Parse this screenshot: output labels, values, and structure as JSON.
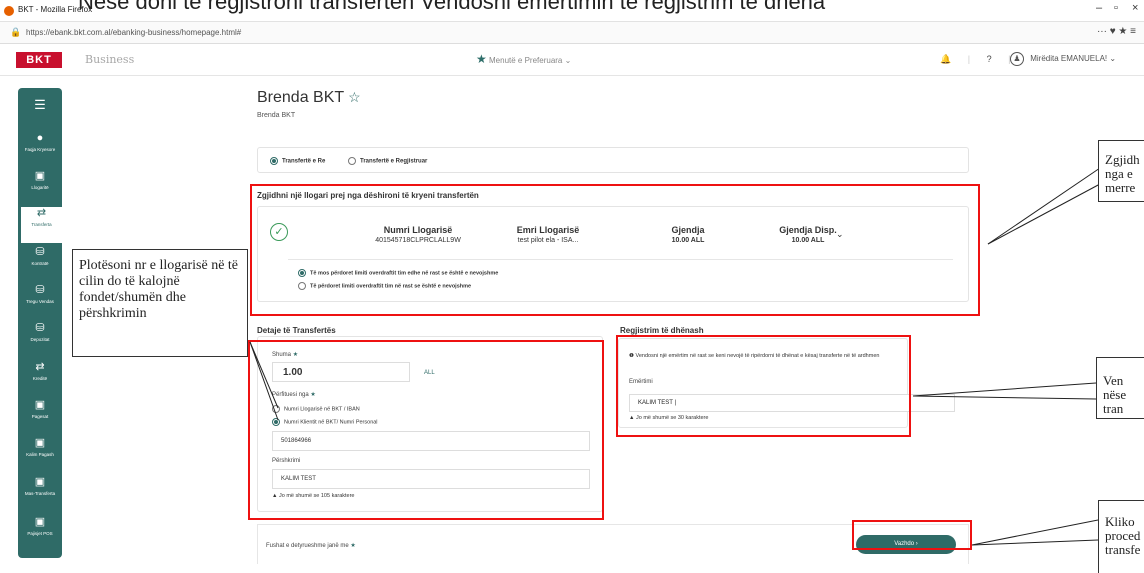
{
  "window": {
    "title": "BKT - Mozilla Firefox",
    "overlay_text": "Nëse doni të regjistroni transferten Vendosni emërtimin të regjistrim të dhëna",
    "controls": [
      "–",
      "▫",
      "×"
    ]
  },
  "browser": {
    "url": "https://ebank.bkt.com.al/ebanking-business/homepage.html#",
    "tools": "··· ♥ ★ ≡"
  },
  "header": {
    "logo": "BKT",
    "product": "Business",
    "menu_pref": "Menutë e Preferuara",
    "help": "?",
    "user": "Mirëdita EMANUELA!"
  },
  "sidebar": {
    "items": [
      {
        "label": "Faqja Kryesore",
        "icon": "home-icon"
      },
      {
        "label": "Llogaritë",
        "icon": "accounts-icon"
      },
      {
        "label": "Transferta",
        "icon": "transfer-icon"
      },
      {
        "label": "Kontratë",
        "icon": "contract-icon"
      },
      {
        "label": "Tregu Vendas",
        "icon": "market-icon"
      },
      {
        "label": "Depozitat",
        "icon": "deposit-icon"
      },
      {
        "label": "Kreditë",
        "icon": "credit-icon"
      },
      {
        "label": "Pagesat",
        "icon": "payments-icon"
      },
      {
        "label": "Kalim Pagash",
        "icon": "payroll-icon"
      },
      {
        "label": "Mas-Transferta",
        "icon": "mass-transfer-icon"
      },
      {
        "label": "Pajisjet POS",
        "icon": "pos-icon"
      }
    ]
  },
  "page": {
    "title": "Brenda BKT",
    "subtitle": "Brenda BKT"
  },
  "transfer_type": {
    "new": "Transfertë e Re",
    "registered": "Transfertë e Regjistruar"
  },
  "account_section": {
    "title": "Zgjidhni një llogari prej nga dëshironi të kryeni transfertën",
    "headers": [
      "Numri Llogarisë",
      "Emri Llogarisë",
      "Gjendja",
      "Gjendja Disp."
    ],
    "values": [
      "401545718CLPRCLALL9W",
      "test pilot ela - ISA...",
      "10.00 ALL",
      "10.00 ALL"
    ],
    "overdraft_no": "Të mos përdoret limiti overdraftit tim edhe në rast se është e nevojshme",
    "overdraft_yes": "Të përdoret limiti overdraftit tim në rast se është e nevojshme"
  },
  "details": {
    "title": "Detaje të Transfertës",
    "amount_label": "Shuma",
    "amount_value": "1.00",
    "currency": "ALL",
    "beneficiary_label": "Përfituesi nga",
    "opt_account": "Numri Llogarisë në BKT / IBAN",
    "opt_client": "Numri Klientit në BKT/ Numri Personal",
    "client_value": "501864966",
    "description_label": "Përshkrimi",
    "description_value": "KALIM TEST",
    "limit_note": "Jo më shumë se 105 karaktere"
  },
  "registration": {
    "title": "Regjistrim të dhënash",
    "info": "Vendosni një emërtim në rast se keni nevojë të ripërdorni të dhënat e kësaj transferte në të ardhmen",
    "name_label": "Emërtimi",
    "name_value": "KALIM TEST |",
    "limit_note": "Jo më shumë se 30 karaktere"
  },
  "footer": {
    "mandatory": "Fushat e detyrueshme janë me",
    "next": "Vazhdo ›"
  },
  "callouts": {
    "left": "Plotësoni nr e llogarisë në të cilin do të kalojnë fondet/shumën dhe përshkrimin",
    "top_right": "Zgjidh nga e merre",
    "mid_right": "Ven nëse tran",
    "bottom_right": "Kliko proced transfe"
  }
}
